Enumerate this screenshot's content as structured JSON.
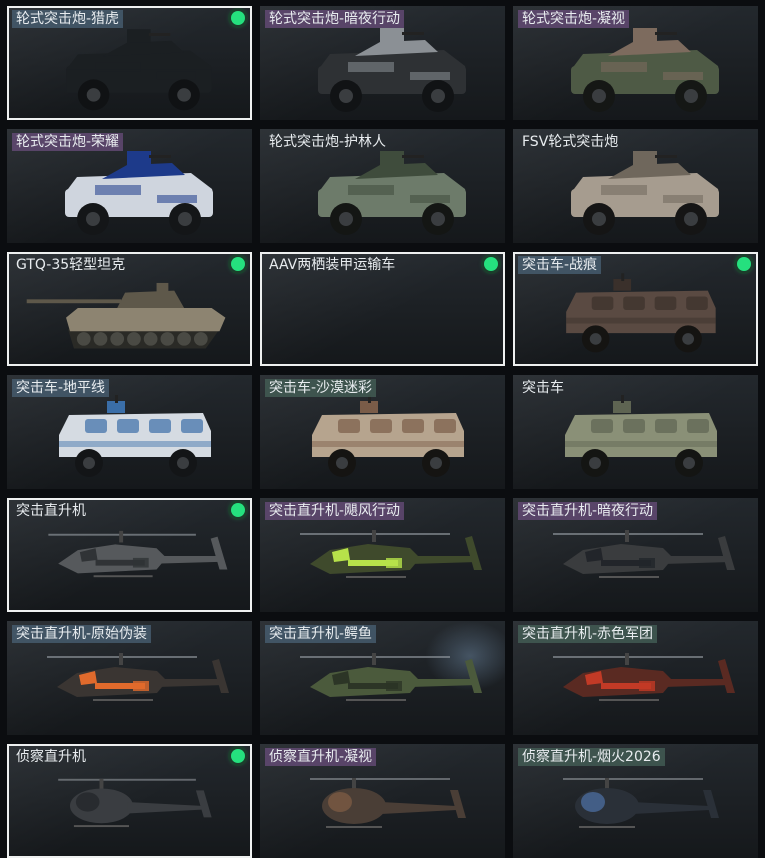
{
  "cards": [
    {
      "label": "轮式突击炮-猎虎",
      "tag": "tag-blue",
      "selected": true,
      "owned": true,
      "vehicle": "wheeled-assault-gun",
      "livery": "none"
    },
    {
      "label": "轮式突击炮-暗夜行动",
      "tag": "tag-purple",
      "selected": false,
      "owned": false,
      "vehicle": "wheeled-assault-gun",
      "livery": "night"
    },
    {
      "label": "轮式突击炮-凝视",
      "tag": "tag-purple",
      "selected": false,
      "owned": false,
      "vehicle": "wheeled-assault-gun",
      "livery": "green-camo"
    },
    {
      "label": "轮式突击炮-荣耀",
      "tag": "tag-purple",
      "selected": false,
      "owned": false,
      "vehicle": "wheeled-assault-gun",
      "livery": "blue-white"
    },
    {
      "label": "轮式突击炮-护林人",
      "tag": "tag-none",
      "selected": false,
      "owned": false,
      "vehicle": "wheeled-assault-gun",
      "livery": "forest"
    },
    {
      "label": "FSV轮式突击炮",
      "tag": "tag-none",
      "selected": false,
      "owned": false,
      "vehicle": "wheeled-assault-gun",
      "livery": "desert"
    },
    {
      "label": "GTQ-35轻型坦克",
      "tag": "tag-none",
      "selected": true,
      "owned": true,
      "vehicle": "light-tank",
      "livery": "tan"
    },
    {
      "label": "AAV两栖装甲运输车",
      "tag": "tag-none",
      "selected": true,
      "owned": true,
      "vehicle": "none",
      "livery": "none"
    },
    {
      "label": "突击车-战痕",
      "tag": "tag-blue",
      "selected": true,
      "owned": true,
      "vehicle": "assault-vehicle",
      "livery": "brown"
    },
    {
      "label": "突击车-地平线",
      "tag": "tag-blue",
      "selected": false,
      "owned": false,
      "vehicle": "assault-vehicle",
      "livery": "white-blue"
    },
    {
      "label": "突击车-沙漠迷彩",
      "tag": "tag-green",
      "selected": false,
      "owned": false,
      "vehicle": "assault-vehicle",
      "livery": "desert-camo"
    },
    {
      "label": "突击车",
      "tag": "tag-none",
      "selected": false,
      "owned": false,
      "vehicle": "assault-vehicle",
      "livery": "olive"
    },
    {
      "label": "突击直升机",
      "tag": "tag-none",
      "selected": true,
      "owned": true,
      "vehicle": "attack-helicopter",
      "livery": "grey"
    },
    {
      "label": "突击直升机-飓风行动",
      "tag": "tag-purple",
      "selected": false,
      "owned": false,
      "vehicle": "attack-helicopter",
      "livery": "neon-green"
    },
    {
      "label": "突击直升机-暗夜行动",
      "tag": "tag-purple",
      "selected": false,
      "owned": false,
      "vehicle": "attack-helicopter",
      "livery": "dark"
    },
    {
      "label": "突击直升机-原始伪装",
      "tag": "tag-blue",
      "selected": false,
      "owned": false,
      "vehicle": "attack-helicopter",
      "livery": "orange"
    },
    {
      "label": "突击直升机-鳄鱼",
      "tag": "tag-blue",
      "selected": false,
      "owned": false,
      "vehicle": "attack-helicopter",
      "livery": "croc-green"
    },
    {
      "label": "突击直升机-赤色军团",
      "tag": "tag-green",
      "selected": false,
      "owned": false,
      "vehicle": "attack-helicopter",
      "livery": "red"
    },
    {
      "label": "侦察直升机",
      "tag": "tag-none",
      "selected": true,
      "owned": true,
      "vehicle": "scout-helicopter",
      "livery": "dark-grey"
    },
    {
      "label": "侦察直升机-凝视",
      "tag": "tag-purple",
      "selected": false,
      "owned": false,
      "vehicle": "scout-helicopter",
      "livery": "camo"
    },
    {
      "label": "侦察直升机-烟火2026",
      "tag": "tag-green",
      "selected": false,
      "owned": false,
      "vehicle": "scout-helicopter",
      "livery": "firework"
    }
  ],
  "colors": {
    "owned_dot": "#25e07e",
    "selected_border": "#eef0f0",
    "background": "#0b0d10",
    "tag_blue": "#4a6276",
    "tag_purple": "#674c78",
    "tag_green": "#466258"
  },
  "liveries": {
    "none": {
      "body": "#1b1f22",
      "accent": "#1b1f22",
      "tire": "#101214"
    },
    "night": {
      "body": "#2e3134",
      "accent": "#8b9095",
      "tire": "#111315"
    },
    "green-camo": {
      "body": "#4e5a45",
      "accent": "#7d6b5e",
      "tire": "#151715"
    },
    "blue-white": {
      "body": "#cfd5de",
      "accent": "#1d3a8a",
      "tire": "#141618"
    },
    "forest": {
      "body": "#6d7b6a",
      "accent": "#3f4c3c",
      "tire": "#141614"
    },
    "desert": {
      "body": "#a69c8f",
      "accent": "#6f675c",
      "tire": "#151515"
    },
    "tan": {
      "body": "#8d8471",
      "accent": "#5e584a",
      "tire": "#1a1a18"
    },
    "brown": {
      "body": "#5a4a42",
      "accent": "#3a302b",
      "tire": "#151412"
    },
    "white-blue": {
      "body": "#d5dbe2",
      "accent": "#3a6ea8",
      "tire": "#131517"
    },
    "desert-camo": {
      "body": "#b6a48e",
      "accent": "#7a5c48",
      "tire": "#151412"
    },
    "olive": {
      "body": "#8a9077",
      "accent": "#5e6452",
      "tire": "#141513"
    },
    "grey": {
      "body": "#56595c",
      "accent": "#303336",
      "tire": "#1a1c1e"
    },
    "neon-green": {
      "body": "#3f4a2c",
      "accent": "#b7e24a",
      "tire": "#1a1c1e"
    },
    "dark": {
      "body": "#3a3c3e",
      "accent": "#22252a",
      "tire": "#1a1c1e"
    },
    "orange": {
      "body": "#3a3532",
      "accent": "#e06a2c",
      "tire": "#1a1c1e"
    },
    "croc-green": {
      "body": "#4b5a3c",
      "accent": "#2c3526",
      "tire": "#1a1c1e"
    },
    "red": {
      "body": "#5a2a22",
      "accent": "#c23a26",
      "tire": "#1a1c1e"
    },
    "dark-grey": {
      "body": "#3a3d41",
      "accent": "#24272b",
      "tire": "#1a1c1e"
    },
    "camo": {
      "body": "#4a3e36",
      "accent": "#7a5a44",
      "tire": "#1a1c1e"
    },
    "firework": {
      "body": "#2a3038",
      "accent": "#4a6a9a",
      "tire": "#1a1c1e"
    }
  }
}
